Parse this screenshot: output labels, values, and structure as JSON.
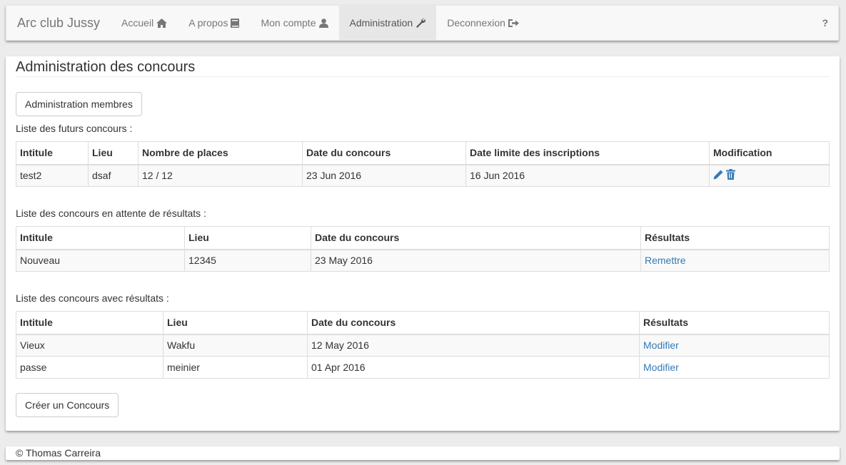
{
  "navbar": {
    "brand": "Arc club Jussy",
    "items": [
      {
        "label": "Accueil",
        "icon": "home-icon"
      },
      {
        "label": "A propos",
        "icon": "book-icon"
      },
      {
        "label": "Mon compte",
        "icon": "user-icon"
      },
      {
        "label": "Administration",
        "icon": "wrench-icon",
        "active": true
      },
      {
        "label": "Deconnexion",
        "icon": "logout-icon"
      }
    ],
    "help": "?"
  },
  "page": {
    "title": "Administration des concours",
    "admin_members_button": "Administration membres",
    "create_button": "Créer un Concours"
  },
  "future": {
    "label": "Liste des futurs concours :",
    "headers": [
      "Intitule",
      "Lieu",
      "Nombre de places",
      "Date du concours",
      "Date limite des inscriptions",
      "Modification"
    ],
    "rows": [
      {
        "intitule": "test2",
        "lieu": "dsaf",
        "places": "12 / 12",
        "date": "23 Jun 2016",
        "limite": "16 Jun 2016"
      }
    ]
  },
  "pending": {
    "label": "Liste des concours en attente de résultats :",
    "headers": [
      "Intitule",
      "Lieu",
      "Date du concours",
      "Résultats"
    ],
    "rows": [
      {
        "intitule": "Nouveau",
        "lieu": "12345",
        "date": "23 May 2016",
        "action": "Remettre"
      }
    ]
  },
  "results": {
    "label": "Liste des concours avec résultats :",
    "headers": [
      "Intitule",
      "Lieu",
      "Date du concours",
      "Résultats"
    ],
    "rows": [
      {
        "intitule": "Vieux",
        "lieu": "Wakfu",
        "date": "12 May 2016",
        "action": "Modifier"
      },
      {
        "intitule": "passe",
        "lieu": "meinier",
        "date": "01 Apr 2016",
        "action": "Modifier"
      }
    ]
  },
  "footer": {
    "text": "© Thomas Carreira"
  },
  "colors": {
    "link": "#337ab7",
    "nav_active_bg": "#e7e7e7",
    "nav_text": "#777777"
  }
}
